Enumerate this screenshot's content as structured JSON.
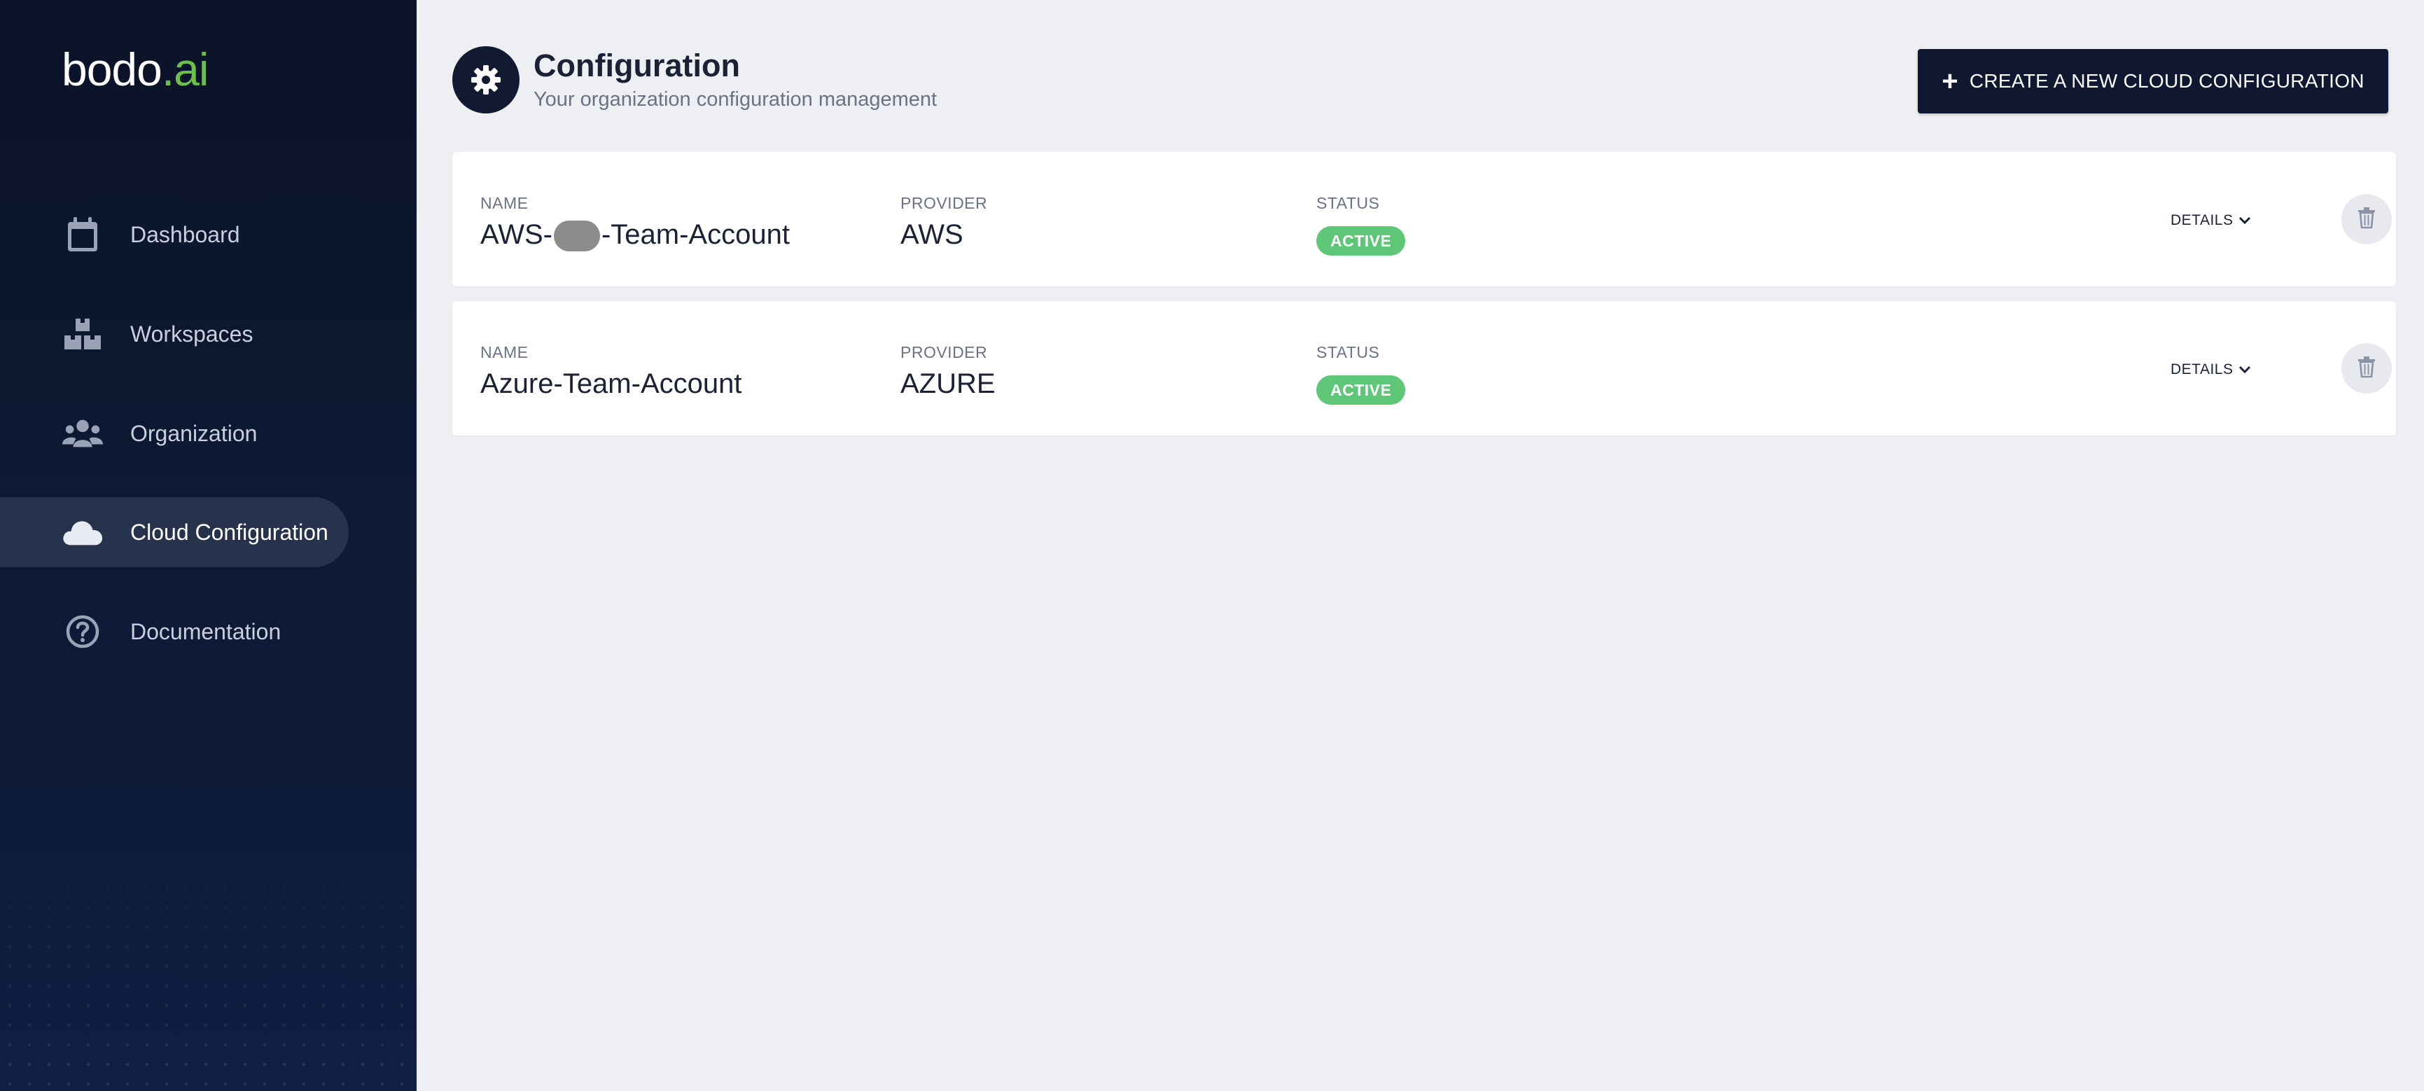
{
  "brand": {
    "logo_main": "bodo",
    "logo_dot": ".",
    "logo_suffix": "ai",
    "accent_color": "#6cc04a"
  },
  "sidebar": {
    "items": [
      {
        "label": "Dashboard",
        "icon": "calendar-icon",
        "active": false
      },
      {
        "label": "Workspaces",
        "icon": "blocks-icon",
        "active": false
      },
      {
        "label": "Organization",
        "icon": "users-icon",
        "active": false
      },
      {
        "label": "Cloud Configuration",
        "icon": "cloud-icon",
        "active": true
      },
      {
        "label": "Documentation",
        "icon": "help-circle-icon",
        "active": false
      }
    ]
  },
  "header": {
    "icon": "gear-icon",
    "title": "Configuration",
    "subtitle": "Your organization configuration management",
    "create_button_label": "CREATE A NEW CLOUD CONFIGURATION"
  },
  "configurations": [
    {
      "name_label": "NAME",
      "name_prefix": "AWS-",
      "name_redacted": true,
      "name_suffix": "-Team-Account",
      "provider_label": "PROVIDER",
      "provider": "AWS",
      "status_label": "STATUS",
      "status": "ACTIVE",
      "details_label": "DETAILS"
    },
    {
      "name_label": "NAME",
      "name": "Azure-Team-Account",
      "provider_label": "PROVIDER",
      "provider": "AZURE",
      "status_label": "STATUS",
      "status": "ACTIVE",
      "details_label": "DETAILS"
    }
  ],
  "colors": {
    "sidebar_bg": "#0b1328",
    "active_item_bg": "#27324d",
    "status_active": "#5ec677",
    "primary_button": "#0f1830"
  }
}
